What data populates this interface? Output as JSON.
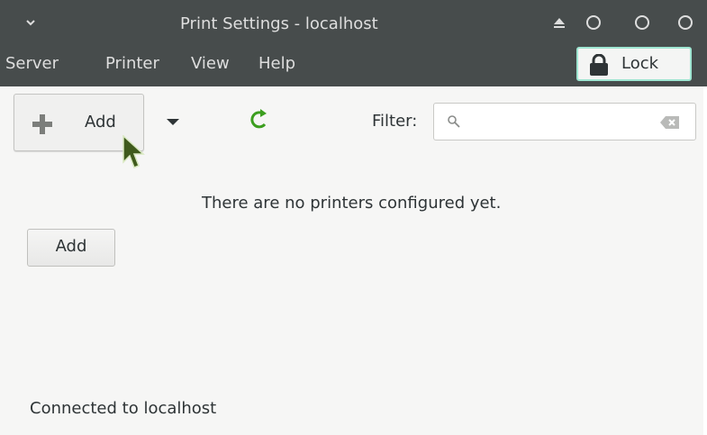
{
  "window": {
    "title": "Print Settings - localhost"
  },
  "menubar": {
    "items": [
      "Server",
      "Printer",
      "View",
      "Help"
    ]
  },
  "lock": {
    "label": "Lock"
  },
  "toolbar": {
    "add_label": "Add",
    "filter_label": "Filter:",
    "filter_value": "",
    "filter_placeholder": ""
  },
  "content": {
    "empty_message": "There are no printers configured yet.",
    "add_button_label": "Add"
  },
  "status": {
    "text": "Connected to localhost"
  },
  "icons": {
    "title_menu": "chevron-down-icon",
    "eject": "eject-icon",
    "window_controls": [
      "minimize-icon",
      "maximize-icon",
      "close-icon"
    ],
    "lock": "lock-icon",
    "add": "plus-icon",
    "dropdown": "dropdown-arrow-icon",
    "refresh": "refresh-icon",
    "search": "search-icon",
    "clear": "clear-icon",
    "cursor": "mouse-cursor-icon"
  },
  "colors": {
    "titlebar_bg": "#474c4c",
    "titlebar_text": "#dedede",
    "lock_border": "#9fe6d2",
    "refresh_green": "#3c9e1f",
    "window_bg": "#f6f6f5"
  }
}
